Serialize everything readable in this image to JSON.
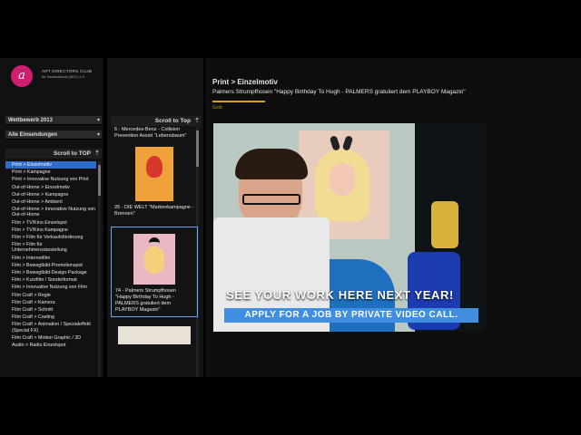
{
  "org": {
    "logo_letter": "a",
    "name": "ART DIRECTORS CLUB",
    "subtitle": "für Deutschland (ADC) e.V."
  },
  "filters": {
    "competition": "Wettbewerb 2013",
    "submissions": "Alle Einsendungen"
  },
  "left_panel": {
    "scroll_label": "Scroll to TOP",
    "categories": [
      "Print > Einzelmotiv",
      "Print > Kampagne",
      "Print > Innovative Nutzung von Print",
      "Out-of-Home > Einzelmotiv",
      "Out-of-Home > Kampagne",
      "Out-of-Home > Ambient",
      "Out-of-Home > Innovative Nutzung von Out-of-Home",
      "Film > TV/Kino Einzelspot",
      "Film > TV/Kino Kampagne",
      "Film > Film für Verkaufsförderung",
      "Film > Film für Unternehmensdarstellung",
      "Film > Internetfilm",
      "Film > Bewegtbild-Promotionspot",
      "Film > Bewegtbild-Design-Package",
      "Film > Kurzfilm / Sonderformat",
      "Film > Innovative Nutzung von Film",
      "Film Craft > Regie",
      "Film Craft > Kamera",
      "Film Craft > Schnitt",
      "Film Craft > Casting",
      "Film Craft > Animation / Spezialeffekt (Special FX)",
      "Film Craft > Motion Graphic / 3D",
      "Audio > Radio Einzelspot"
    ],
    "active_index": 0
  },
  "entries_panel": {
    "scroll_label": "Scroll to Top",
    "entries": [
      {
        "text": "6 - Mercedes-Benz - Collision Prevention Assist \"Lebensbaum\""
      },
      {
        "text": "26 - DIE WELT \"Markenkampagne - Brennen\""
      },
      {
        "text": "74 - Palmers Strumpfhosen \"Happy Birthday To Hugh - PALMERS gratuliert dem PLAYBOY Magazin\""
      }
    ]
  },
  "detail": {
    "breadcrumb": "Print > Einzelmotiv",
    "title": "Palmers Strumpfhosen \"Happy Birthday To Hugh - PALMERS gratuliert dem PLAYBOY Magazin\"",
    "award": "Gold"
  },
  "overlay": {
    "headline": "SEE YOUR WORK HERE NEXT YEAR!",
    "cta": "APPLY FOR A JOB BY PRIVATE VIDEO CALL."
  },
  "colors": {
    "accent": "#d01f6e",
    "active": "#2f6cc7",
    "gold": "#d4a317"
  }
}
